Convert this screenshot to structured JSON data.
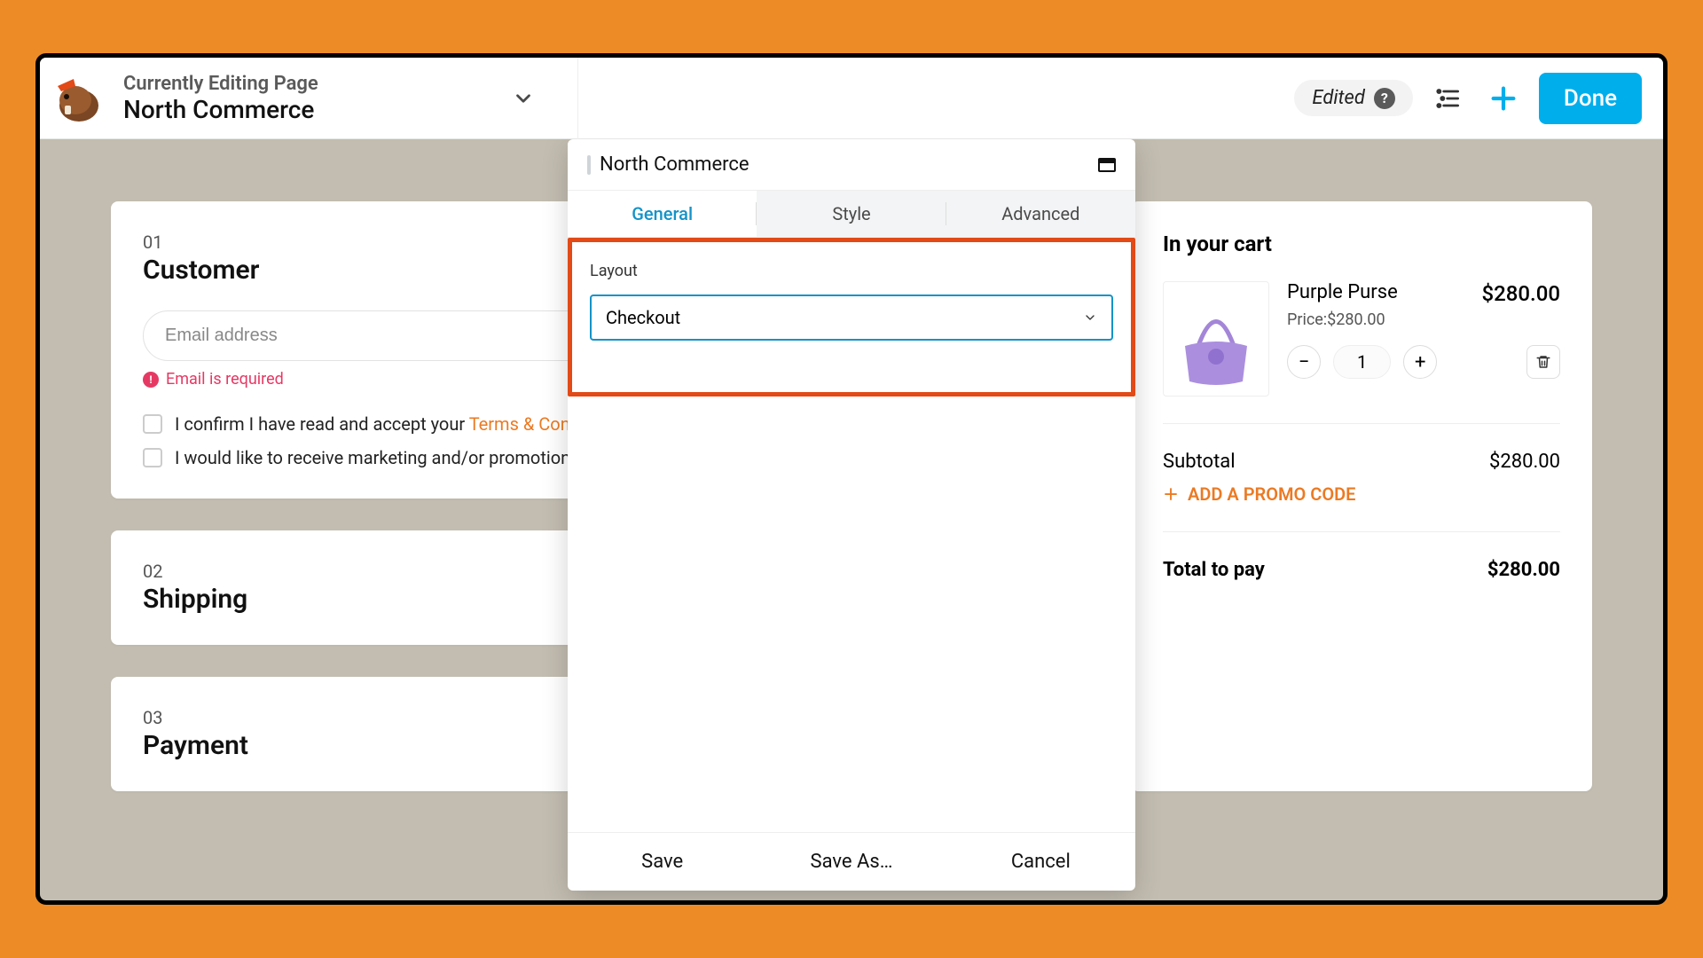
{
  "topbar": {
    "subtitle": "Currently Editing Page",
    "title": "North Commerce",
    "edited_label": "Edited",
    "done_label": "Done"
  },
  "panel": {
    "title": "North Commerce",
    "tabs": {
      "general": "General",
      "style": "Style",
      "advanced": "Advanced"
    },
    "layout_label": "Layout",
    "layout_value": "Checkout",
    "footer": {
      "save": "Save",
      "save_as": "Save As…",
      "cancel": "Cancel"
    }
  },
  "checkout": {
    "step1": {
      "num": "01",
      "title": "Customer",
      "email_placeholder": "Email address",
      "email_error": "Email is required",
      "terms_prefix": "I confirm I have read and accept your ",
      "terms_link": "Terms & Conditions",
      "marketing": "I would like to receive marketing and/or promotional emails"
    },
    "step2": {
      "num": "02",
      "title": "Shipping"
    },
    "step3": {
      "num": "03",
      "title": "Payment"
    }
  },
  "cart": {
    "heading": "In your cart",
    "item": {
      "name": "Purple Purse",
      "price_label": "Price:",
      "unit_price": "$280.00",
      "line_price": "$280.00",
      "qty": "1"
    },
    "subtotal_label": "Subtotal",
    "subtotal": "$280.00",
    "promo": "ADD A PROMO CODE",
    "total_label": "Total to pay",
    "total": "$280.00"
  }
}
